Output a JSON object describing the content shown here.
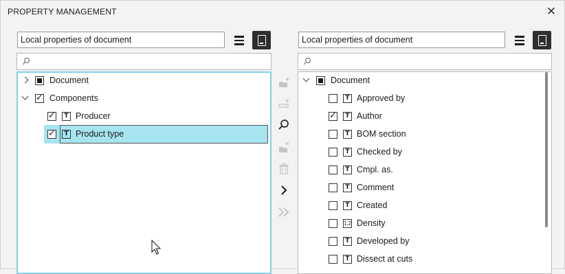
{
  "window": {
    "title": "PROPERTY MANAGEMENT",
    "close_glyph": "✕"
  },
  "left": {
    "source_combo": "Local properties of document",
    "search_placeholder": "",
    "tree": [
      {
        "label": "Document",
        "expander": "collapsed",
        "check": "partial"
      },
      {
        "label": "Components",
        "expander": "expanded",
        "check": "checked"
      },
      {
        "label": "Producer",
        "check": "checked",
        "type": "T"
      },
      {
        "label": "Product type",
        "check": "checked",
        "type": "T",
        "selected": true
      }
    ]
  },
  "right": {
    "source_combo": "Local properties of document",
    "search_placeholder": "",
    "tree_root": {
      "label": "Document",
      "expander": "expanded",
      "check": "partial"
    },
    "items": [
      {
        "label": "Approved by",
        "checked": false,
        "type": "T"
      },
      {
        "label": "Author",
        "checked": true,
        "type": "T"
      },
      {
        "label": "BOM section",
        "checked": false,
        "type": "T"
      },
      {
        "label": "Checked by",
        "checked": false,
        "type": "T"
      },
      {
        "label": "Cmpl. as.",
        "checked": false,
        "type": "T"
      },
      {
        "label": "Comment",
        "checked": false,
        "type": "T"
      },
      {
        "label": "Created",
        "checked": false,
        "type": "T"
      },
      {
        "label": "Density",
        "checked": false,
        "type": "1.2"
      },
      {
        "label": "Developed by",
        "checked": false,
        "type": "T"
      },
      {
        "label": "Dissect at cuts",
        "checked": false,
        "type": "T"
      }
    ]
  },
  "toolbar": {
    "icons": [
      "add-folder-icon",
      "add-property-icon",
      "search-icon",
      "delete-folder-icon",
      "trash-icon",
      "chevron-right-icon",
      "double-chevron-right-icon"
    ],
    "enabled_color": "#1a1a1a",
    "disabled_color": "#b5b5b5"
  },
  "colors": {
    "selection": "#a6e4f0",
    "focus_border": "#7fd3e6"
  }
}
